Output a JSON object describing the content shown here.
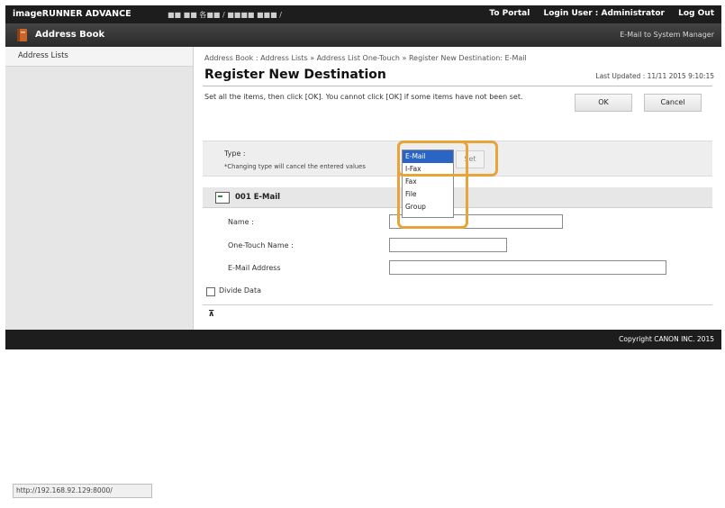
{
  "topbar": {
    "brand": "imageRUNNER ADVANCE",
    "device": "■■ ■■ 各■■ / ■■■■ ■■■ /",
    "to_portal": "To Portal",
    "login_user": "Login User : Administrator",
    "logout": "Log Out"
  },
  "titlebar": {
    "title": "Address Book",
    "icon": "address-book-icon",
    "manager": "E-Mail to System Manager"
  },
  "sidebar": {
    "items": [
      {
        "label": "Address Lists"
      }
    ]
  },
  "main": {
    "breadcrumb": "Address Book : Address Lists » Address List One-Touch » Register New Destination: E-Mail",
    "heading": "Register New Destination",
    "last_updated": "Last Updated : 11/11 2015 9:10:15",
    "instructions": "Set all the items, then click [OK]. You cannot click [OK] if some items have not been set.",
    "ok_label": "OK",
    "cancel_label": "Cancel",
    "type_label": "Type :",
    "type_note": "*Changing type will cancel the entered values",
    "type_options": [
      "E-Mail",
      "I-Fax",
      "Fax",
      "File",
      "Group"
    ],
    "type_selected": "E-Mail",
    "set_label": "Set",
    "section_title": "001 E-Mail",
    "fields": {
      "name_label": "Name :",
      "name_value": "",
      "onetouch_label": "One-Touch Name :",
      "onetouch_value": "",
      "email_label": "E-Mail Address",
      "email_value": ""
    },
    "divide_label": "Divide Data",
    "divide_checked": false,
    "top_arrow": "⊼"
  },
  "footer": {
    "copyright": "Copyright CANON INC. 2015"
  },
  "status": {
    "url": "http://192.168.92.129:8000/"
  },
  "colors": {
    "highlight": "#e9a33b",
    "selected": "#2a64c5",
    "topbar": "#1d1d1d"
  }
}
